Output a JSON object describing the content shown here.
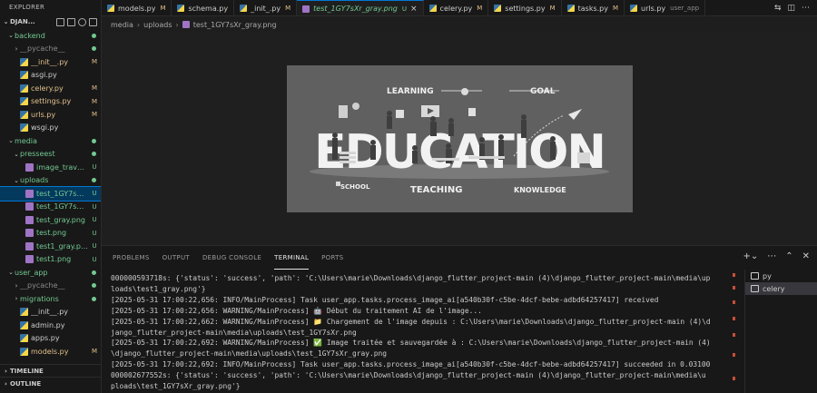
{
  "sidebar": {
    "title": "EXPLORER",
    "project": "DJAN...",
    "items": [
      {
        "indent": 1,
        "kind": "dir",
        "open": true,
        "label": "backend",
        "color": "c-untr",
        "badge": "",
        "dot": "#73c991"
      },
      {
        "indent": 2,
        "kind": "dir",
        "open": false,
        "label": "__pycache__",
        "color": "c-dim",
        "badge": "",
        "dot": "#73c991"
      },
      {
        "indent": 2,
        "kind": "py",
        "label": "__init__.py",
        "color": "c-mod",
        "badge": "M",
        "dot": ""
      },
      {
        "indent": 2,
        "kind": "py",
        "label": "asgi.py",
        "color": "c-plain",
        "badge": "",
        "dot": ""
      },
      {
        "indent": 2,
        "kind": "py",
        "label": "celery.py",
        "color": "c-mod",
        "badge": "M",
        "dot": ""
      },
      {
        "indent": 2,
        "kind": "py",
        "label": "settings.py",
        "color": "c-mod",
        "badge": "M",
        "dot": ""
      },
      {
        "indent": 2,
        "kind": "py",
        "label": "urls.py",
        "color": "c-mod",
        "badge": "M",
        "dot": ""
      },
      {
        "indent": 2,
        "kind": "py",
        "label": "wsgi.py",
        "color": "c-plain",
        "badge": "",
        "dot": ""
      },
      {
        "indent": 1,
        "kind": "dir",
        "open": true,
        "label": "media",
        "color": "c-untr",
        "badge": "",
        "dot": "#73c991"
      },
      {
        "indent": 2,
        "kind": "dir",
        "open": true,
        "label": "presseest",
        "color": "c-untr",
        "badge": "",
        "dot": "#73c991"
      },
      {
        "indent": 3,
        "kind": "img",
        "label": "image_travaill...",
        "color": "c-untr",
        "badge": "U",
        "dot": ""
      },
      {
        "indent": 2,
        "kind": "dir",
        "open": true,
        "label": "uploads",
        "color": "c-untr",
        "badge": "",
        "dot": "#73c991"
      },
      {
        "indent": 3,
        "kind": "img",
        "label": "test_1GY7sXr_...",
        "color": "c-untr",
        "badge": "U",
        "dot": "",
        "selected": true
      },
      {
        "indent": 3,
        "kind": "img",
        "label": "test_1GY7sXr....",
        "color": "c-untr",
        "badge": "U",
        "dot": ""
      },
      {
        "indent": 3,
        "kind": "img",
        "label": "test_gray.png",
        "color": "c-untr",
        "badge": "U",
        "dot": ""
      },
      {
        "indent": 3,
        "kind": "img",
        "label": "test.png",
        "color": "c-untr",
        "badge": "U",
        "dot": ""
      },
      {
        "indent": 3,
        "kind": "img",
        "label": "test1_gray.png",
        "color": "c-untr",
        "badge": "U",
        "dot": ""
      },
      {
        "indent": 3,
        "kind": "img",
        "label": "test1.png",
        "color": "c-untr",
        "badge": "U",
        "dot": ""
      },
      {
        "indent": 1,
        "kind": "dir",
        "open": true,
        "label": "user_app",
        "color": "c-untr",
        "badge": "",
        "dot": "#73c991"
      },
      {
        "indent": 2,
        "kind": "dir",
        "open": false,
        "label": "__pycache__",
        "color": "c-dim",
        "badge": "",
        "dot": "#73c991"
      },
      {
        "indent": 2,
        "kind": "dir",
        "open": false,
        "label": "migrations",
        "color": "c-untr",
        "badge": "",
        "dot": "#73c991"
      },
      {
        "indent": 2,
        "kind": "py",
        "label": "__init__.py",
        "color": "c-plain",
        "badge": "",
        "dot": ""
      },
      {
        "indent": 2,
        "kind": "py",
        "label": "admin.py",
        "color": "c-plain",
        "badge": "",
        "dot": ""
      },
      {
        "indent": 2,
        "kind": "py",
        "label": "apps.py",
        "color": "c-plain",
        "badge": "",
        "dot": ""
      },
      {
        "indent": 2,
        "kind": "py",
        "label": "models.py",
        "color": "c-mod",
        "badge": "M",
        "dot": ""
      }
    ],
    "sections": [
      "TIMELINE",
      "OUTLINE"
    ]
  },
  "tabs": [
    {
      "label": "models.py",
      "badge": "M",
      "kind": "py",
      "active": false
    },
    {
      "label": "schema.py",
      "badge": "",
      "kind": "py",
      "active": false
    },
    {
      "label": "_init_.py",
      "badge": "M",
      "kind": "py",
      "active": false
    },
    {
      "label": "test_1GY7sXr_gray.png",
      "badge": "U",
      "kind": "img",
      "active": true
    },
    {
      "label": "celery.py",
      "badge": "M",
      "kind": "py",
      "active": false
    },
    {
      "label": "settings.py",
      "badge": "M",
      "kind": "py",
      "active": false
    },
    {
      "label": "tasks.py",
      "badge": "M",
      "kind": "py",
      "active": false
    },
    {
      "label": "urls.py",
      "badge": "user_app",
      "kind": "py",
      "active": false
    }
  ],
  "breadcrumb": {
    "part1": "media",
    "part2": "uploads",
    "file": "test_1GY7sXr_gray.png"
  },
  "image": {
    "word_main": "EDUCATION",
    "labels": [
      "LEARNING",
      "GOAL",
      "SCHOOL",
      "TEACHING",
      "KNOWLEDGE"
    ]
  },
  "panel": {
    "tabs": [
      "PROBLEMS",
      "OUTPUT",
      "DEBUG CONSOLE",
      "TERMINAL",
      "PORTS"
    ],
    "active_tab": "TERMINAL",
    "terminal_lines": [
      "000000593718s: {'status': 'success', 'path': 'C:\\Users\\marie\\Downloads\\django_flutter_project-main (4)\\django_flutter_project-main\\media\\up",
      "loads\\test1_gray.png'}",
      "[2025-05-31 17:00:22,656: INFO/MainProcess] Task user_app.tasks.process_image_ai[a540b30f-c5be-4dcf-bebe-adbd64257417] received",
      "[2025-05-31 17:00:22,656: WARNING/MainProcess] 🤖 Début du traitement AI de l'image...",
      "[2025-05-31 17:00:22,662: WARNING/MainProcess] 📁 Chargement de l'image depuis : C:\\Users\\marie\\Downloads\\django_flutter_project-main (4)\\d",
      "jango_flutter_project-main\\media\\uploads\\test_1GY7sXr.png",
      "[2025-05-31 17:00:22,692: WARNING/MainProcess] ✅ Image traitée et sauvegardée à : C:\\Users\\marie\\Downloads\\django_flutter_project-main (4)",
      "\\django_flutter_project-main\\media\\uploads\\test_1GY7sXr_gray.png",
      "[2025-05-31 17:00:22,692: INFO/MainProcess] Task user_app.tasks.process_image_ai[a540b30f-c5be-4dcf-bebe-adbd64257417] succeeded in 0.03100",
      "000002677552s: {'status': 'success', 'path': 'C:\\Users\\marie\\Downloads\\django_flutter_project-main (4)\\django_flutter_project-main\\media\\u",
      "ploads\\test_1GY7sXr_gray.png'}"
    ],
    "terminals": [
      {
        "label": "py",
        "active": false
      },
      {
        "label": "celery",
        "active": true
      }
    ]
  },
  "colors": {
    "accent": "#0078d4",
    "modified": "#e2c08d",
    "untracked": "#73c991",
    "error_mark": "#c74e39"
  }
}
